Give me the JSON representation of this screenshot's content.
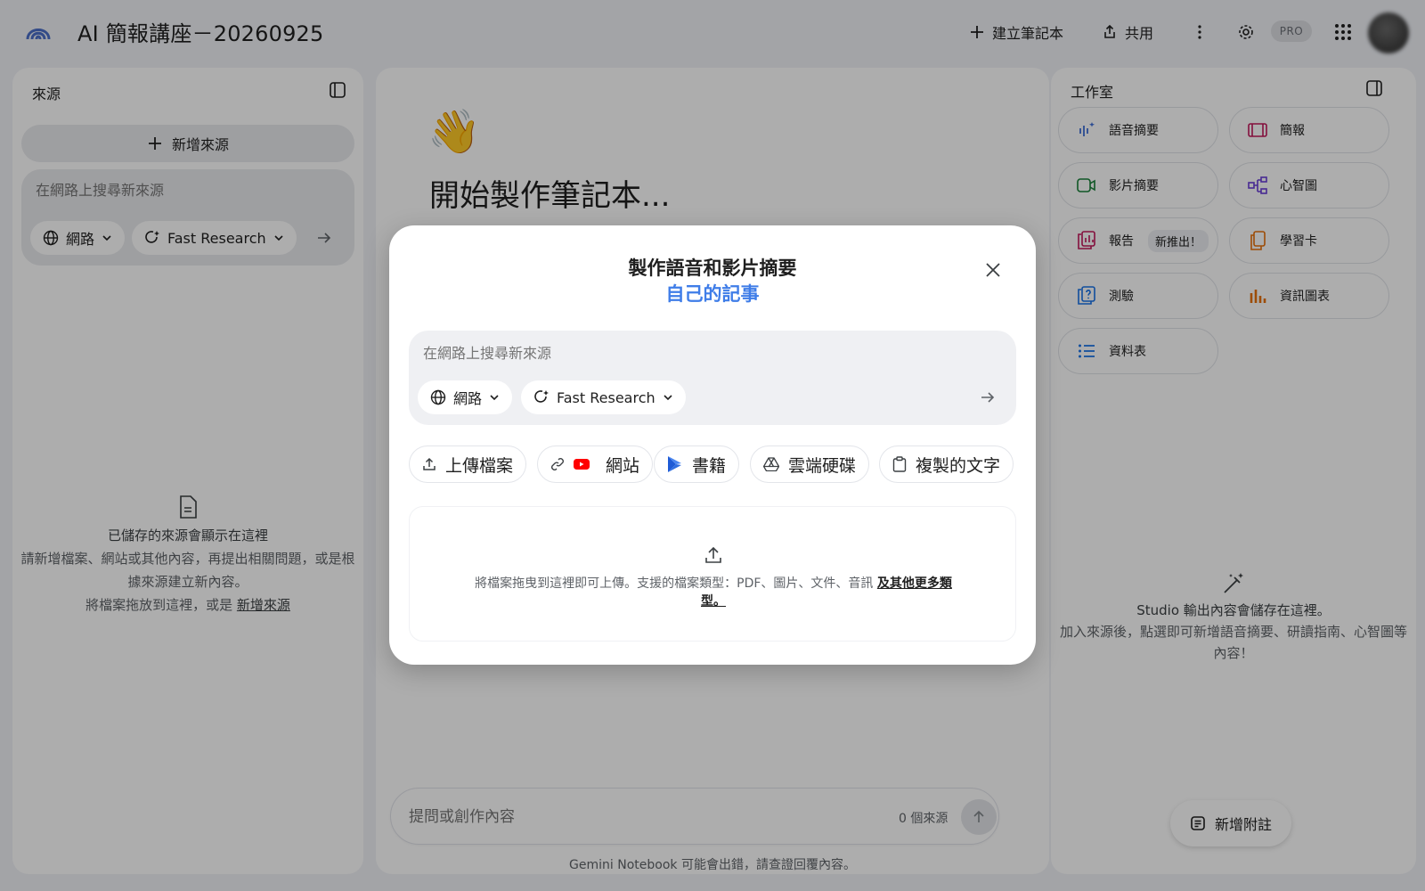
{
  "app": {
    "title": "AI 簡報講座－20260925"
  },
  "toolbar": {
    "create_label": "建立筆記本",
    "share_label": "共用",
    "pro_label": "PRO"
  },
  "sources": {
    "title": "來源",
    "add_label": "新增來源",
    "search_placeholder": "在網路上搜尋新來源",
    "web_chip": "網路",
    "research_chip": "Fast Research",
    "empty_title": "已儲存的來源會顯示在這裡",
    "empty_body": "請新增檔案、網站或其他內容，再提出相關問題，或是根據來源建立新內容。",
    "empty_drop": "將檔案拖放到這裡，或是",
    "empty_link": "新增來源"
  },
  "chat": {
    "emoji": "👋",
    "heading": "開始製作筆記本...",
    "input_placeholder": "提問或創作內容",
    "source_count": "0 個來源",
    "disclaimer": "Gemini Notebook 可能會出錯，請查證回覆內容。"
  },
  "studio": {
    "title": "工作室",
    "tiles": [
      {
        "label": "語音摘要",
        "icon": "audio-overview-icon",
        "color": "#3f6fd8"
      },
      {
        "label": "簡報",
        "icon": "slides-icon",
        "color": "#c2185b"
      },
      {
        "label": "影片摘要",
        "icon": "video-overview-icon",
        "color": "#188038"
      },
      {
        "label": "心智圖",
        "icon": "mind-map-icon",
        "color": "#6b3fd8"
      },
      {
        "label": "報告",
        "icon": "report-icon",
        "color": "#c2185b",
        "badge": "新推出！"
      },
      {
        "label": "學習卡",
        "icon": "flashcards-icon",
        "color": "#e8710a"
      },
      {
        "label": "測驗",
        "icon": "quiz-icon",
        "color": "#1a73e8"
      },
      {
        "label": "資訊圖表",
        "icon": "infographic-icon",
        "color": "#e8710a"
      },
      {
        "label": "資料表",
        "icon": "data-table-icon",
        "color": "#1a73e8"
      }
    ],
    "empty_title": "Studio 輸出內容會儲存在這裡。",
    "empty_body": "加入來源後，點選即可新增語音摘要、研讀指南、心智圖等內容！",
    "add_note_label": "新增附註"
  },
  "modal": {
    "title": "製作語音和影片摘要",
    "subtitle": "自己的記事",
    "search_placeholder": "在網路上搜尋新來源",
    "web_chip": "網路",
    "research_chip": "Fast Research",
    "source_options": [
      {
        "label": "上傳檔案",
        "icon": "upload-icon"
      },
      {
        "label": "網站",
        "icon": "link-icon"
      },
      {
        "label": "書籍",
        "icon": "books-icon"
      },
      {
        "label": "雲端硬碟",
        "icon": "drive-icon"
      },
      {
        "label": "複製的文字",
        "icon": "clipboard-icon"
      }
    ],
    "drop_text": "將檔案拖曳到這裡即可上傳。支援的檔案類型：PDF、圖片、文件、音訊",
    "drop_more": "及其他更多類型。"
  },
  "colors": {
    "accent": "#3f7de8",
    "overlay": "rgba(0,0,0,0.32)"
  }
}
